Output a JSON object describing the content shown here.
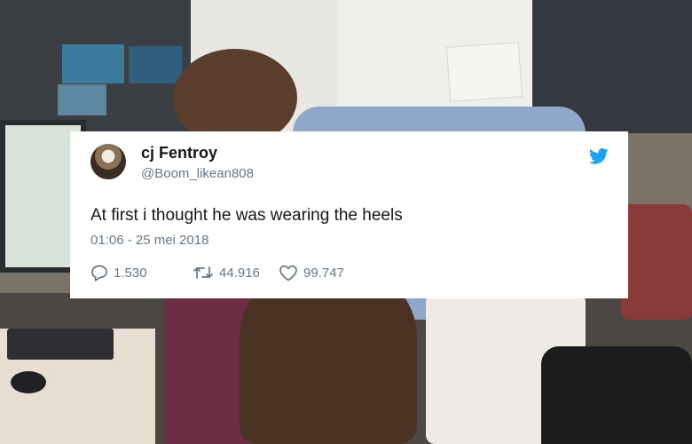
{
  "tweet": {
    "display_name": "cj Fentroy",
    "handle": "@Boom_likean808",
    "text": "At first i thought he was wearing the heels",
    "timestamp": "01:06 - 25 mei 2018",
    "replies": "1.530",
    "retweets": "44.916",
    "likes": "99.747",
    "brand_color": "#1da1f2",
    "icons": [
      "twitter-bird-icon",
      "reply-icon",
      "retweet-icon",
      "like-heart-icon"
    ]
  }
}
